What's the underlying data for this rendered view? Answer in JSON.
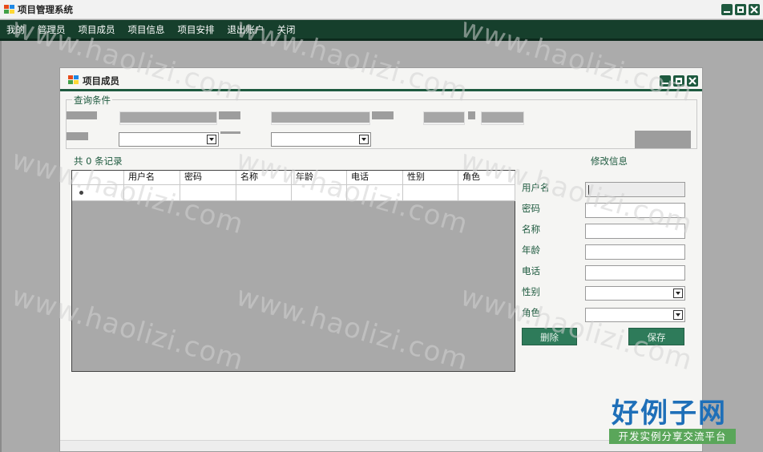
{
  "app": {
    "title": "项目管理系统"
  },
  "menu": [
    "我的",
    "管理员",
    "项目成员",
    "项目信息",
    "项目安排",
    "退出账户",
    "关闭"
  ],
  "child_window": {
    "title": "项目成员"
  },
  "query": {
    "legend": "查询条件"
  },
  "records": {
    "count_label": "共 0 条记录"
  },
  "grid": {
    "columns": [
      "",
      "用户名",
      "密码",
      "名称",
      "年龄",
      "电话",
      "性别",
      "角色"
    ]
  },
  "edit_form": {
    "title": "修改信息",
    "labels": [
      "用户名",
      "密码",
      "名称",
      "年龄",
      "电话",
      "性别",
      "角色"
    ],
    "delete_label": "删除",
    "save_label": "保存"
  },
  "watermark": {
    "text": "www.haolizi.com"
  },
  "logo": {
    "big": "好例子网",
    "small": "开发实例分享交流平台"
  },
  "colors": {
    "accent": "#1e5a3f",
    "menubar": "#163f2c",
    "button": "#2e7b5a",
    "logo_blue": "#1e6fb8",
    "logo_green": "#5aa65a"
  },
  "icons": [
    "app-icon",
    "minimize-icon",
    "maximize-icon",
    "close-icon",
    "dropdown-arrow-icon",
    "row-indicator-icon"
  ]
}
